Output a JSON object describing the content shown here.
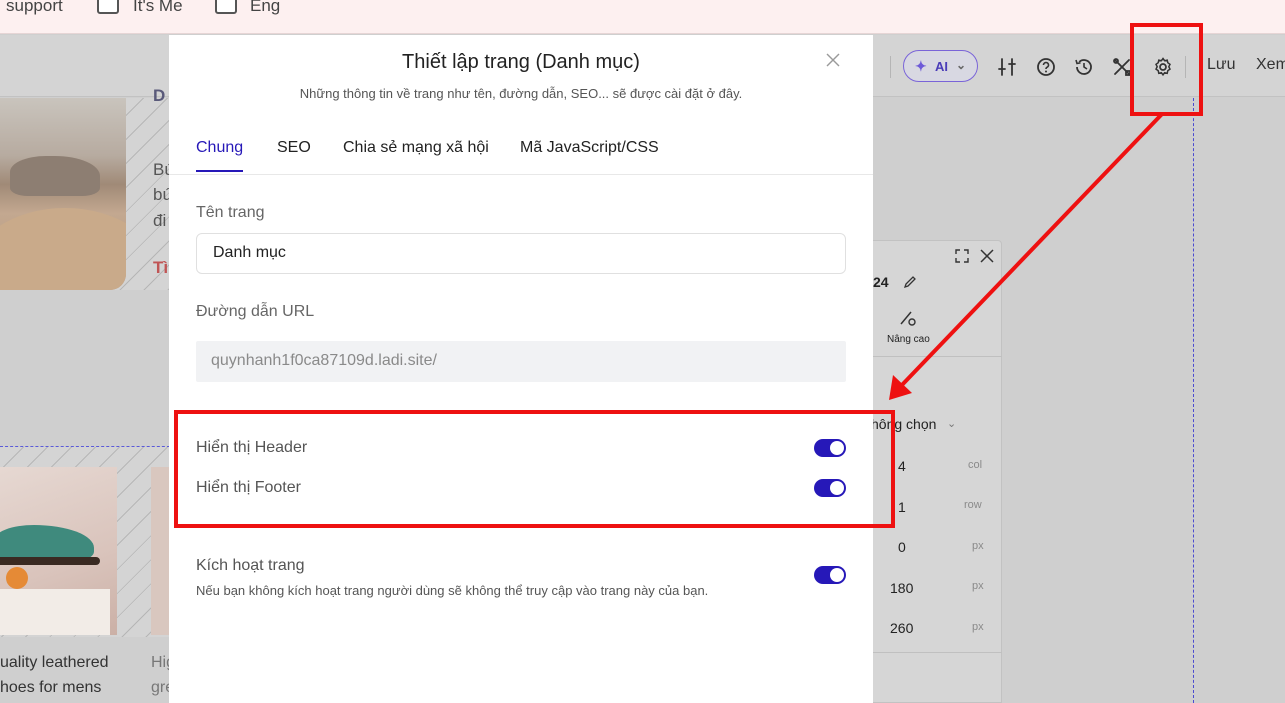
{
  "top_strip": {
    "item1": "support",
    "item2": "It's Me",
    "item3": "Eng"
  },
  "toolbar": {
    "ai_label": "AI",
    "save_label": "Lưu",
    "view_label": "Xem"
  },
  "background_canvas": {
    "text_lines": [
      "D",
      "Bú",
      "bú",
      "đi",
      "Tì"
    ],
    "caption_left_1": "uality leathered",
    "caption_left_2": "hoes for mens",
    "caption_right_1": "Hig",
    "caption_right_2": "gre"
  },
  "side_panel": {
    "title_fragment": "24",
    "advanced_label": "Nâng cao",
    "select_value": "hông chọn",
    "rows": [
      {
        "value": "4",
        "unit": "col"
      },
      {
        "value": "1",
        "unit": "row"
      },
      {
        "value": "0",
        "unit": "px"
      },
      {
        "value": "180",
        "unit": "px"
      },
      {
        "value": "260",
        "unit": "px"
      }
    ]
  },
  "modal": {
    "title": "Thiết lập trang (Danh mục)",
    "subtitle": "Những thông tin về trang như tên, đường dẫn, SEO... sẽ được cài đặt ở đây.",
    "tabs": [
      {
        "label": "Chung",
        "active": true
      },
      {
        "label": "SEO",
        "active": false
      },
      {
        "label": "Chia sẻ mạng xã hội",
        "active": false
      },
      {
        "label": "Mã JavaScript/CSS",
        "active": false
      }
    ],
    "page_name_label": "Tên trang",
    "page_name_value": "Danh mục",
    "url_label": "Đường dẫn URL",
    "url_value": "quynhanh1f0ca87109d.ladi.site/",
    "show_header_label": "Hiển thị Header",
    "show_header_on": true,
    "show_footer_label": "Hiển thị Footer",
    "show_footer_on": true,
    "activate_label": "Kích hoạt trang",
    "activate_help": "Nếu bạn không kích hoạt trang người dùng sẽ không thể truy cập vào trang này của bạn.",
    "activate_on": true
  },
  "colors": {
    "accent": "#2618b8",
    "annotation": "#ee1111",
    "overlay": "#cfcfcf"
  },
  "icons": [
    "sparkle-icon",
    "chevron-down-icon",
    "sliders-icon",
    "help-circle-icon",
    "history-icon",
    "tools-icon",
    "gear-icon",
    "close-icon",
    "expand-icon",
    "edit-icon",
    "settings-advanced-icon"
  ]
}
